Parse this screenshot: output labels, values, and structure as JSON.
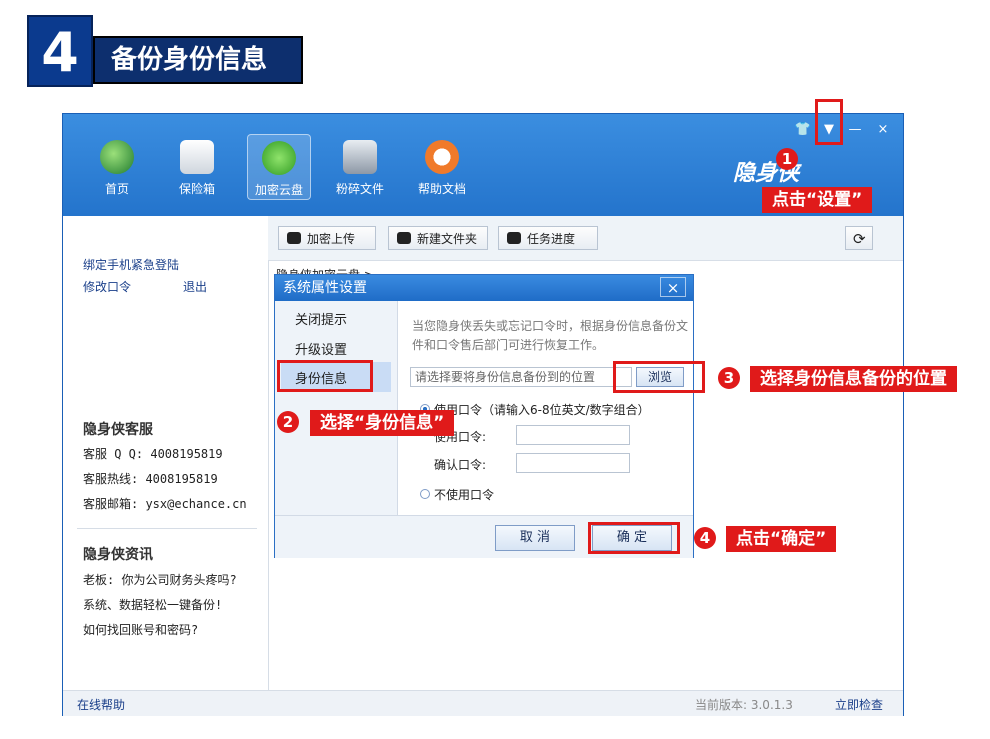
{
  "step": {
    "number": "4",
    "title": "备份身份信息"
  },
  "toolbar": {
    "home": "首页",
    "vault": "保险箱",
    "cloud": "加密云盘",
    "shred": "粉碎文件",
    "help": "帮助文档"
  },
  "brand": "隐身侠",
  "window_controls": {
    "shirt": "👕",
    "menu": "▼",
    "min": "—",
    "close": "×"
  },
  "sidebar": {
    "bind_phone": "绑定手机紧急登陆",
    "change_pw": "修改口令",
    "logout": "退出",
    "service_title": "隐身侠客服",
    "qq": "客服 Q Q: 4008195819",
    "hotline": "客服热线: 4008195819",
    "email": "客服邮箱: ysx@echance.cn",
    "news_title": "隐身侠资讯",
    "news": [
      "老板: 你为公司财务头疼吗?",
      "系统、数据轻松一键备份!",
      "如何找回账号和密码?"
    ]
  },
  "main_toolbar": {
    "upload": "加密上传",
    "new_folder": "新建文件夹",
    "progress": "任务进度"
  },
  "breadcrumb": "隐身侠加密云盘 >",
  "statusbar": {
    "help": "在线帮助",
    "version": "当前版本: 3.0.1.3",
    "check": "立即检查"
  },
  "dialog": {
    "title": "系统属性设置",
    "close": "×",
    "nav": [
      "关闭提示",
      "升级设置",
      "身份信息"
    ],
    "note": "当您隐身侠丢失或忘记口令时，根据身份信息备份文件和口令售后部门可进行恢复工作。",
    "location_placeholder": "请选择要将身份信息备份到的位置",
    "browse": "浏览",
    "use_pw": "使用口令（请输入6-8位英文/数字组合）",
    "pw_label": "使用口令:",
    "confirm_label": "确认口令:",
    "no_pw": "不使用口令",
    "cancel": "取 消",
    "ok": "确 定"
  },
  "annotations": {
    "a1_num": "1",
    "a1_text": "点击“设置”",
    "a2_num": "2",
    "a2_text": "选择“身份信息”",
    "a3_num": "3",
    "a3_text": "选择身份信息备份的位置",
    "a4_num": "4",
    "a4_text": "点击“确定”"
  },
  "colors": {
    "accent": "#2c7fd6",
    "annotation": "#e01a1a",
    "header": "#0d2f6e"
  }
}
